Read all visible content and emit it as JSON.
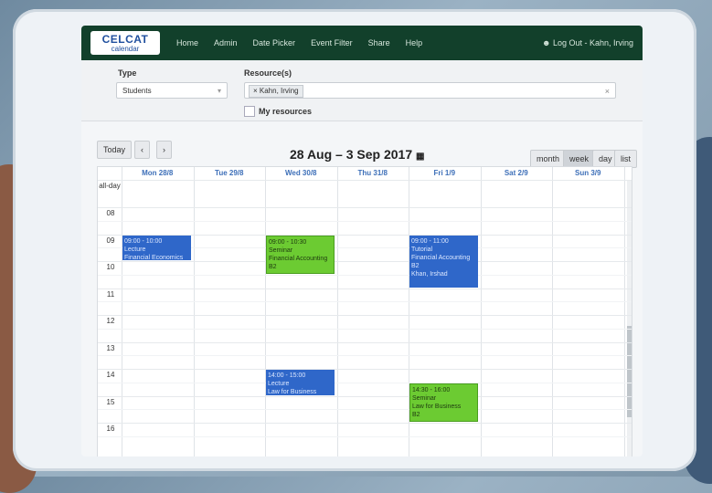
{
  "logo": {
    "line1": "CELCAT",
    "line2": "calendar"
  },
  "nav": [
    "Home",
    "Admin",
    "Date Picker",
    "Event Filter",
    "Share",
    "Help"
  ],
  "logout": "Log Out - Kahn, Irving",
  "filters": {
    "type_label": "Type",
    "type_value": "Students",
    "resources_label": "Resource(s)",
    "resource_tag": "× Kahn, Irving",
    "my_resources_label": "My resources"
  },
  "toolbar": {
    "today": "Today",
    "prev": "‹",
    "next": "›",
    "range": "28 Aug – 3 Sep 2017",
    "views": [
      "month",
      "week",
      "day",
      "list"
    ],
    "active_view": "week"
  },
  "calendar": {
    "days": [
      "Mon 28/8",
      "Tue 29/8",
      "Wed 30/8",
      "Thu 31/8",
      "Fri 1/9",
      "Sat 2/9",
      "Sun 3/9"
    ],
    "allday_label": "all-day",
    "hours": [
      "08",
      "09",
      "10",
      "11",
      "12",
      "13",
      "14",
      "15",
      "16"
    ],
    "events": [
      {
        "day": 0,
        "start": 9.0,
        "end": 10.0,
        "color": "blue",
        "lines": [
          "09:00 - 10:00",
          "Lecture",
          "Financial Economics"
        ]
      },
      {
        "day": 2,
        "start": 9.0,
        "end": 10.5,
        "color": "green",
        "lines": [
          "09:00 - 10:30",
          "Seminar",
          "Financial Accounting",
          "B2"
        ]
      },
      {
        "day": 4,
        "start": 9.0,
        "end": 11.0,
        "color": "blue",
        "lines": [
          "09:00 - 11:00",
          "Tutorial",
          "Financial Accounting",
          "B2",
          "Khan, Irshad"
        ]
      },
      {
        "day": 2,
        "start": 14.0,
        "end": 15.0,
        "color": "blue",
        "lines": [
          "14:00 - 15:00",
          "Lecture",
          "Law for Business"
        ]
      },
      {
        "day": 4,
        "start": 14.5,
        "end": 16.0,
        "color": "green",
        "lines": [
          "14:30 - 16:00",
          "Seminar",
          "Law for Business",
          "B2"
        ]
      }
    ]
  },
  "colors": {
    "topbar": "#12402b",
    "event_blue": "#2f67c9",
    "event_green": "#6ccb32"
  }
}
